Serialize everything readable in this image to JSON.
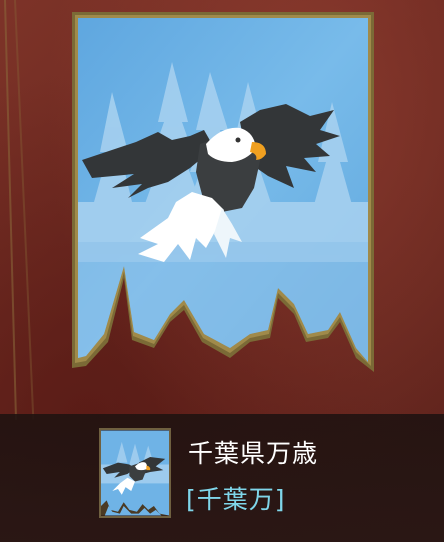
{
  "banner": {
    "name": "千葉県万歳",
    "tag": "[千葉万]",
    "emblem_icon": "bald-eagle-icon",
    "colors": {
      "sky": "#6fb3e6",
      "tree_silhouette": "#a9d2f0",
      "frame": "#7b6a36",
      "background": "#6a2820",
      "tag_text": "#7fd6ea"
    }
  }
}
